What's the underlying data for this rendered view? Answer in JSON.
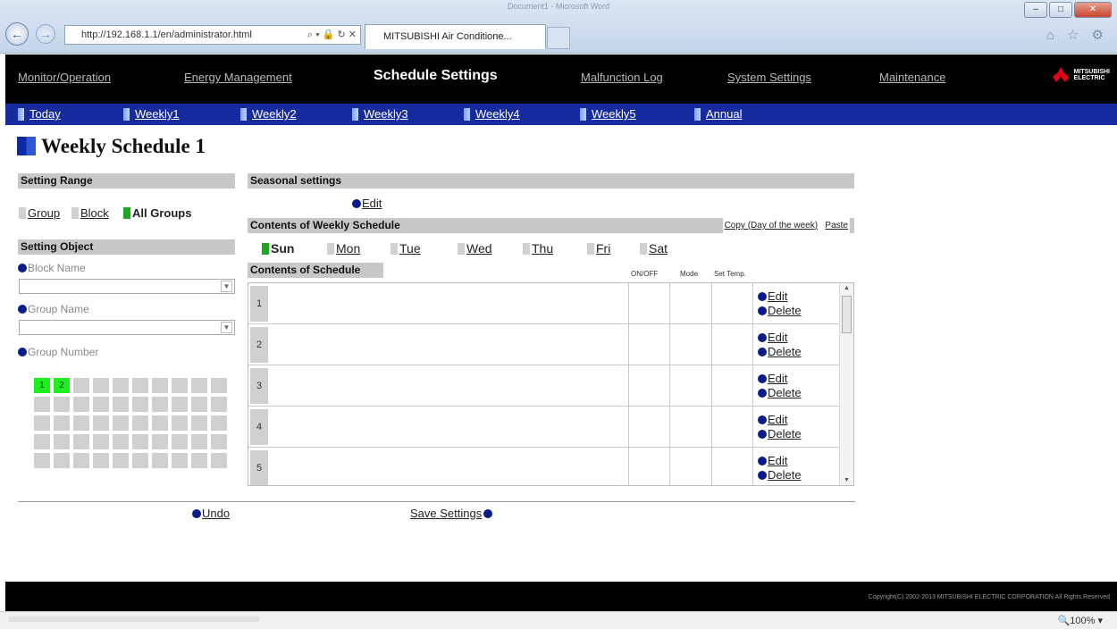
{
  "browser": {
    "title": "Document1 - Microsoft Word",
    "address": "http://192.168.1.1/en/administrator.html",
    "search_controls": "⌕ ▾ 🔒 ↻ ✕",
    "tab_title": "MITSUBISHI Air Conditione...",
    "right_icons": "⌂ ☆ ⚙"
  },
  "topnav": {
    "items": [
      "Monitor/Operation",
      "Energy Management",
      "Schedule Settings",
      "Malfunction Log",
      "System Settings",
      "Maintenance"
    ],
    "active": "Schedule Settings",
    "logo_line1": "MITSUBISHI",
    "logo_line2": "ELECTRIC"
  },
  "subnav": {
    "items": [
      "Today",
      "Weekly1",
      "Weekly2",
      "Weekly3",
      "Weekly4",
      "Weekly5",
      "Annual"
    ]
  },
  "page": {
    "title": "Weekly Schedule 1"
  },
  "left": {
    "setting_range_header": "Setting Range",
    "range_options": [
      "Group",
      "Block",
      "All Groups"
    ],
    "range_selected": "All Groups",
    "setting_object_header": "Setting Object",
    "block_name_label": "Block Name",
    "block_name_value": "",
    "group_name_label": "Group Name",
    "group_name_value": "",
    "group_number_label": "Group Number",
    "active_groups": [
      "1",
      "2"
    ]
  },
  "seasonal": {
    "header": "Seasonal settings",
    "edit_label": "Edit"
  },
  "weekly": {
    "header": "Contents of Weekly Schedule",
    "copy_label": "Copy (Day of the week)",
    "paste_label": "Paste",
    "days": [
      "Sun",
      "Mon",
      "Tue",
      "Wed",
      "Thu",
      "Fri",
      "Sat"
    ],
    "selected_day": "Sun"
  },
  "schedule": {
    "header": "Contents of Schedule",
    "columns": [
      "ON/OFF",
      "Mode",
      "Set Temp."
    ],
    "rows": [
      "1",
      "2",
      "3",
      "4",
      "5"
    ],
    "edit_label": "Edit",
    "delete_label": "Delete"
  },
  "actions": {
    "undo_label": "Undo",
    "save_label": "Save Settings"
  },
  "footer": {
    "copyright": "Copyright(C) 2002-2013 MITSUBISHI ELECTRIC CORPORATION All Rights Reserved"
  },
  "status": {
    "zoom": "🔍100%  ▾"
  }
}
